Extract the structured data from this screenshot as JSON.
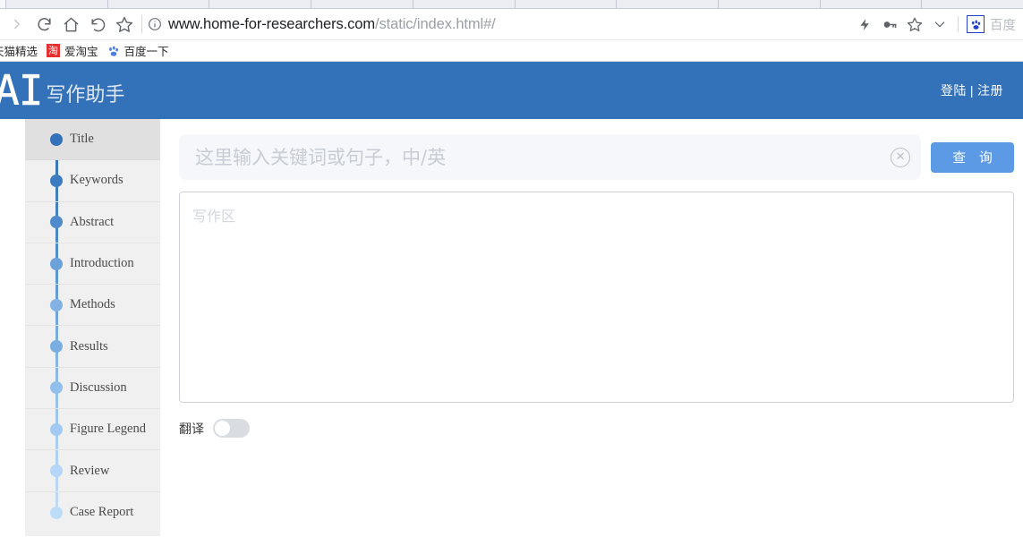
{
  "browser": {
    "url_host": "www.home-for-researchers.com",
    "url_path": "/static/index.html#/",
    "nav": {
      "forward": "forward-arrow",
      "reload": "reload-icon",
      "home": "home-icon",
      "back_history": "undo-arrow",
      "bookmark_star": "star-icon"
    },
    "toolbar_icons": {
      "lightning": "lightning-icon",
      "key": "key-icon",
      "star": "star-icon",
      "chevron": "chevron-down-icon"
    },
    "extension": {
      "icon": "baidu-paw-icon",
      "label": "百度"
    },
    "bookmarks": [
      {
        "label": "天猫精选",
        "icon": "none"
      },
      {
        "label": "爱淘宝",
        "icon": "taobao-icon",
        "icon_text": "淘"
      },
      {
        "label": "百度一下",
        "icon": "baidu-paw-icon"
      }
    ]
  },
  "header": {
    "logo_main": "AI",
    "logo_sub": "写作助手",
    "login_label": "登陆",
    "separator": "|",
    "register_label": "注册"
  },
  "sidebar": {
    "items": [
      {
        "label": "Title",
        "dot_color": "#3371b8",
        "active": true
      },
      {
        "label": "Keywords",
        "dot_color": "#3d7cc0",
        "active": false
      },
      {
        "label": "Abstract",
        "dot_color": "#4f8bcc",
        "active": false
      },
      {
        "label": "Introduction",
        "dot_color": "#6ba2da",
        "active": false
      },
      {
        "label": "Methods",
        "dot_color": "#82b2e4",
        "active": false
      },
      {
        "label": "Results",
        "dot_color": "#7aade2",
        "active": false
      },
      {
        "label": "Discussion",
        "dot_color": "#92bfec",
        "active": false
      },
      {
        "label": "Figure Legend",
        "dot_color": "#a3cbf2",
        "active": false
      },
      {
        "label": "Review",
        "dot_color": "#b5d6f6",
        "active": false
      },
      {
        "label": "Case Report",
        "dot_color": "#bcdcf8",
        "active": false
      }
    ]
  },
  "main": {
    "search": {
      "value": "",
      "placeholder": "这里输入关键词或句子，中/英",
      "clear_icon": "circle-close-icon",
      "button_label": "查 询"
    },
    "editor": {
      "value": "",
      "placeholder": "写作区"
    },
    "translate": {
      "label": "翻译",
      "enabled": false
    }
  },
  "colors": {
    "header_blue": "#3371b8",
    "button_blue": "#5c9ae5",
    "sidebar_bg": "#f0f0f0",
    "active_row": "#e0e0e0"
  }
}
